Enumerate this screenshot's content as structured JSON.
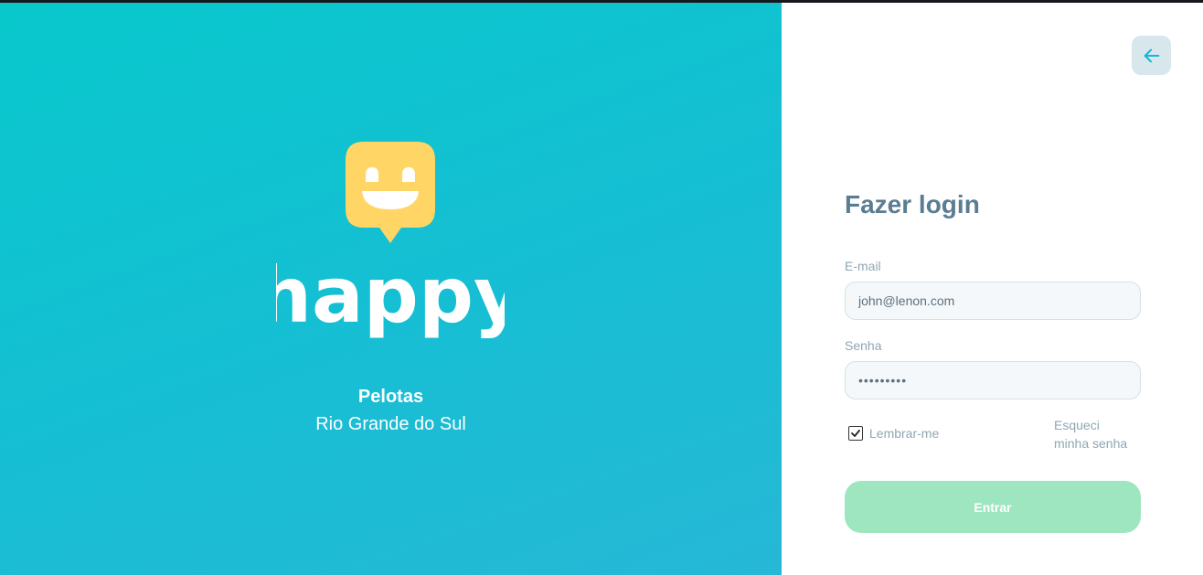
{
  "brand": {
    "name": "happy",
    "city": "Pelotas",
    "state": "Rio Grande do Sul"
  },
  "login": {
    "title": "Fazer login",
    "email_label": "E-mail",
    "email_value": "john@lenon.com",
    "password_label": "Senha",
    "password_value": "•••••••••",
    "remember_label": "Lembrar-me",
    "remember_checked": true,
    "forgot_line1": "Esqueci",
    "forgot_line2": "minha senha",
    "submit_label": "Entrar"
  },
  "icons": {
    "back": "arrow-left-icon",
    "logo": "smiley-pin-icon",
    "remember": "check-icon"
  },
  "colors": {
    "gradient_start": "#08c8cc",
    "gradient_end": "#26b8d6",
    "logo_yellow": "#ffd666",
    "title_color": "#5b7d93",
    "submit_bg": "#9de6c0",
    "back_arrow": "#15b6d6"
  }
}
